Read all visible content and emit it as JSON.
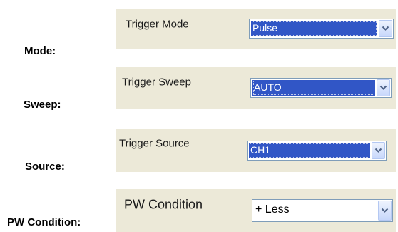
{
  "settings": [
    {
      "side_label": "Mode:",
      "panel_label": "Trigger Mode",
      "value": "Pulse",
      "highlighted": true
    },
    {
      "side_label": "Sweep:",
      "panel_label": "Trigger Sweep",
      "value": "AUTO",
      "highlighted": true
    },
    {
      "side_label": "Source:",
      "panel_label": "Trigger Source",
      "value": "CH1",
      "highlighted": true
    },
    {
      "side_label": "PW Condition:",
      "panel_label": "PW Condition",
      "value": "+ Less",
      "highlighted": false
    }
  ],
  "icons": {
    "dropdown": "chevron-down-icon"
  },
  "colors": {
    "panel_bg": "#ece9d8",
    "selection": "#3156c6",
    "combo_border": "#7f9db9"
  }
}
